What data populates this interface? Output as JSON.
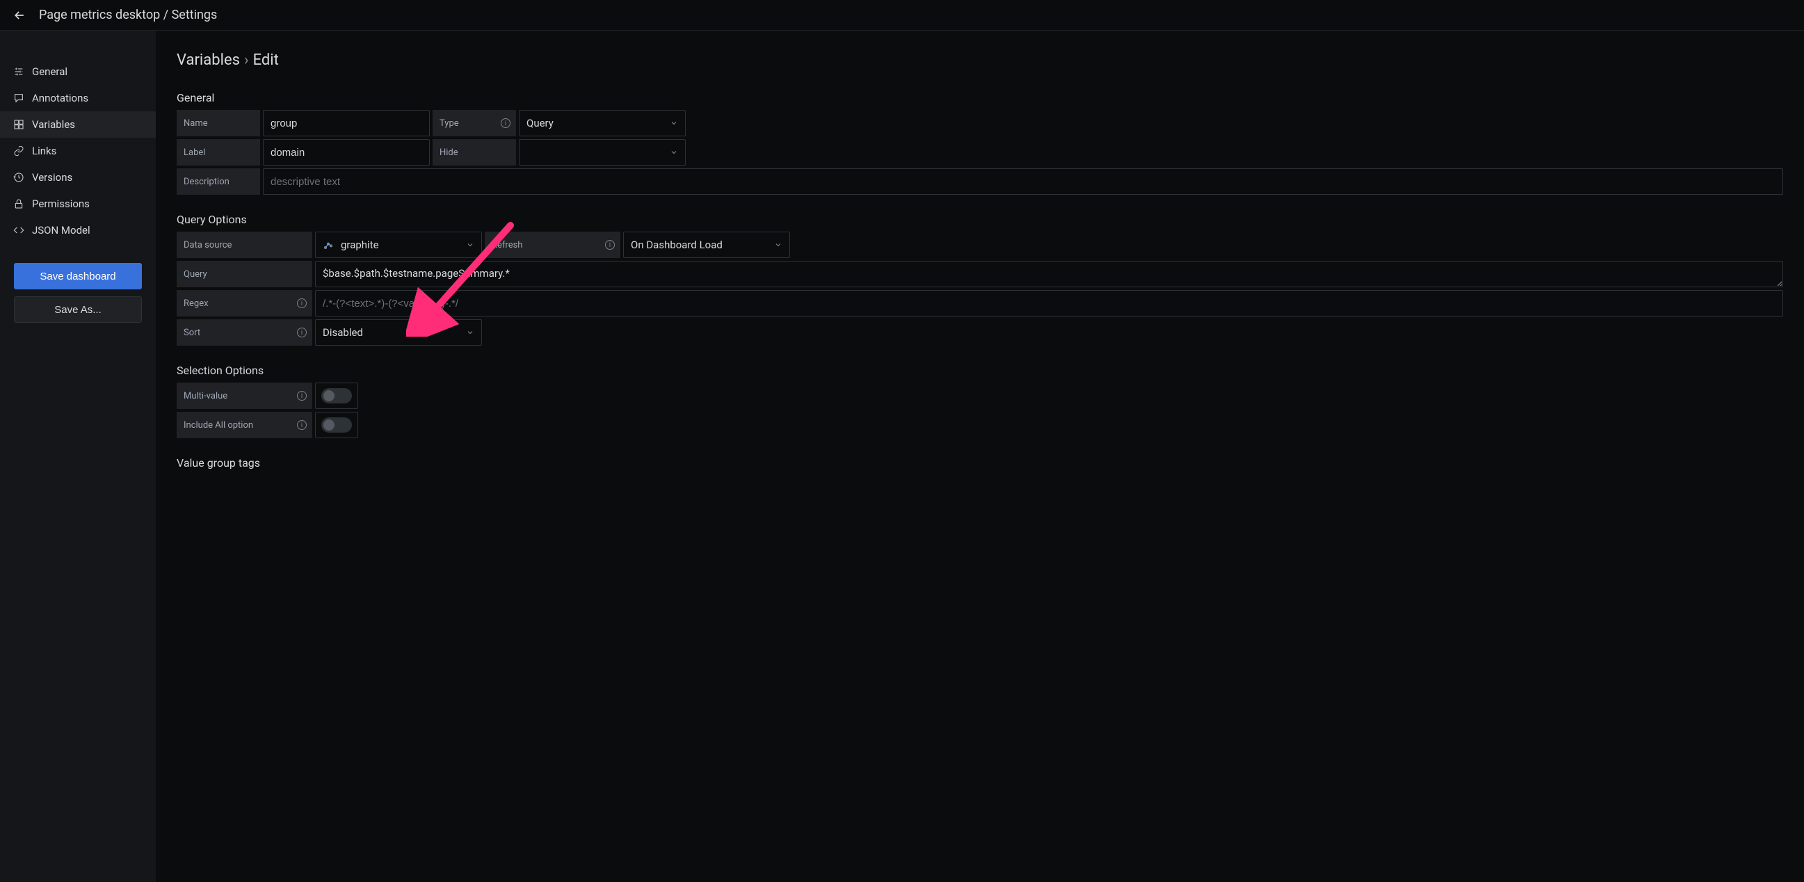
{
  "header": {
    "breadcrumb": "Page metrics desktop / Settings"
  },
  "sidebar": {
    "items": [
      {
        "label": "General"
      },
      {
        "label": "Annotations"
      },
      {
        "label": "Variables"
      },
      {
        "label": "Links"
      },
      {
        "label": "Versions"
      },
      {
        "label": "Permissions"
      },
      {
        "label": "JSON Model"
      }
    ],
    "save_label": "Save dashboard",
    "save_as_label": "Save As..."
  },
  "page": {
    "title_prefix": "Variables",
    "title_suffix": "Edit"
  },
  "sections": {
    "general": "General",
    "query_options": "Query Options",
    "selection_options": "Selection Options",
    "value_group_tags": "Value group tags"
  },
  "form": {
    "name_label": "Name",
    "name_value": "group",
    "type_label": "Type",
    "type_value": "Query",
    "label_label": "Label",
    "label_value": "domain",
    "hide_label": "Hide",
    "hide_value": "",
    "description_label": "Description",
    "description_placeholder": "descriptive text",
    "datasource_label": "Data source",
    "datasource_value": "graphite",
    "refresh_label": "Refresh",
    "refresh_value": "On Dashboard Load",
    "query_label": "Query",
    "query_value": "$base.$path.$testname.pageSummary.*",
    "regex_label": "Regex",
    "regex_placeholder": "/.*-(?<text>.*)-(?<value>.*)-.*/",
    "sort_label": "Sort",
    "sort_value": "Disabled",
    "multivalue_label": "Multi-value",
    "includeall_label": "Include All option"
  }
}
